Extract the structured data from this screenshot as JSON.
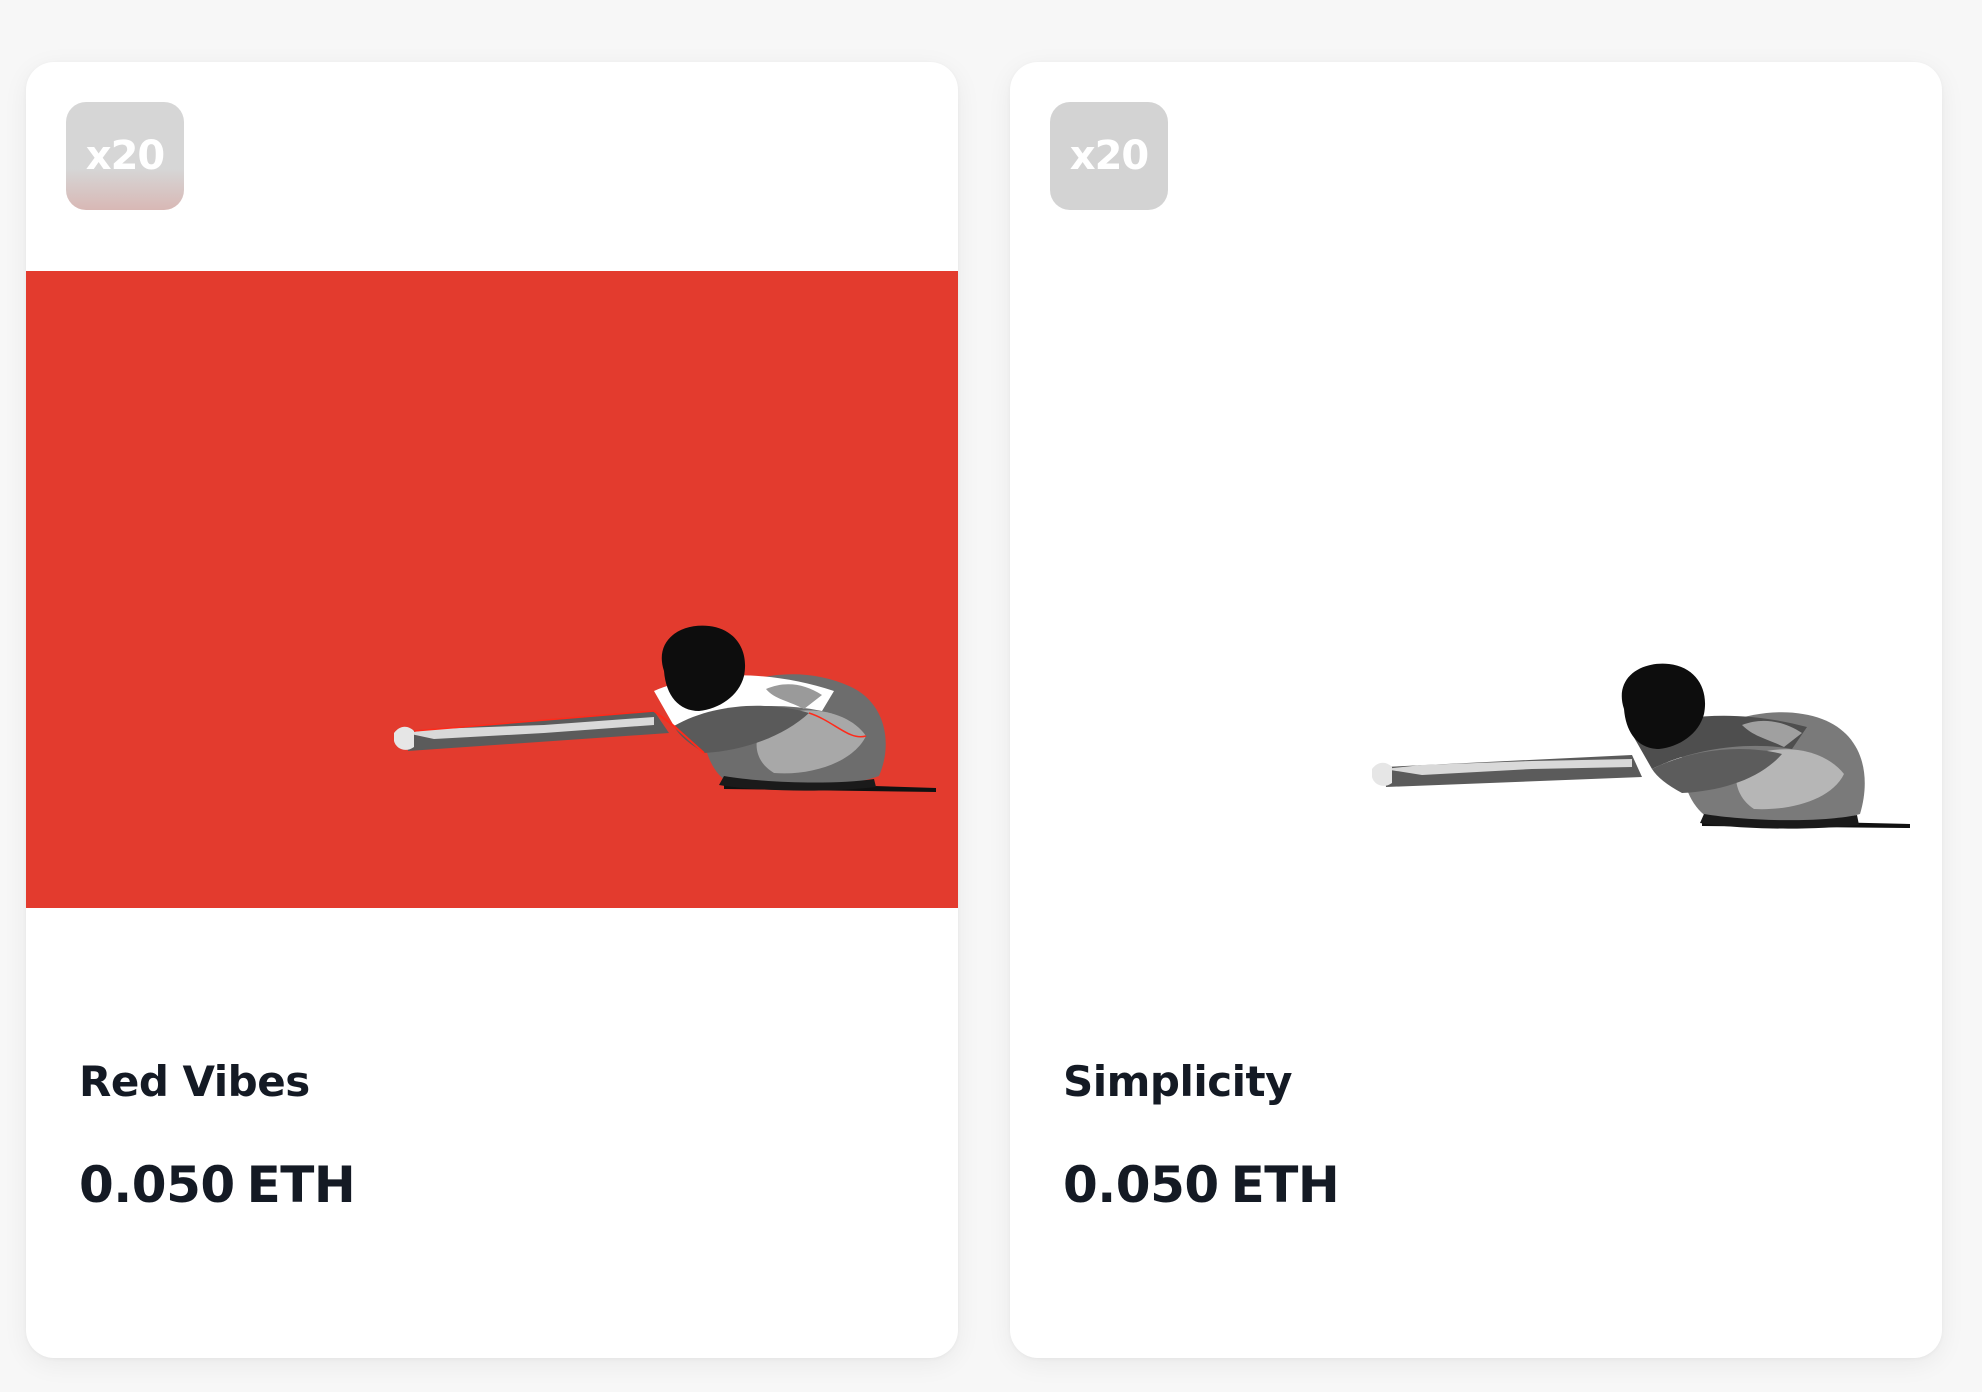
{
  "cards": [
    {
      "badge": "x20",
      "title": "Red Vibes",
      "price_value": "0.050",
      "price_currency": "ETH",
      "art_background": "#e33b2e",
      "art_style": "red"
    },
    {
      "badge": "x20",
      "title": "Simplicity",
      "price_value": "0.050",
      "price_currency": "ETH",
      "art_background": "#ffffff",
      "art_style": "mono"
    }
  ],
  "colors": {
    "page_bg": "#f7f7f7",
    "card_bg": "#ffffff",
    "badge_bg": "#d3d3d3",
    "text": "#141a24"
  }
}
